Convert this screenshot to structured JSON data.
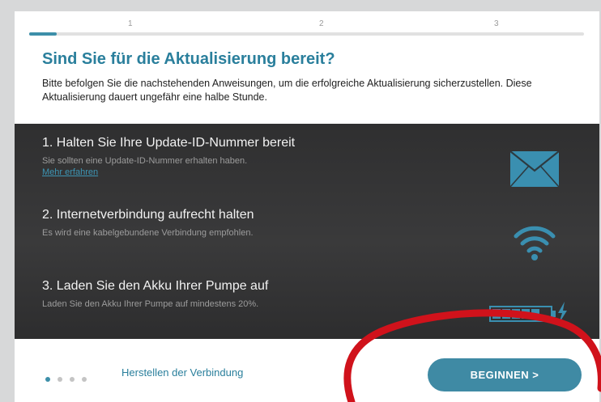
{
  "steps": {
    "labels": [
      "1",
      "2",
      "3"
    ],
    "progress_fraction": 0.05
  },
  "header": {
    "title": "Sind Sie für die Aktualisierung bereit?",
    "intro": "Bitte befolgen Sie die nachstehenden Anweisungen, um die erfolgreiche Aktualisierung sicherzustellen. Diese Aktualisierung dauert ungefähr eine halbe Stunde."
  },
  "instructions": [
    {
      "title": "1. Halten Sie Ihre Update-ID-Nummer bereit",
      "description": "Sie sollten eine Update-ID-Nummer erhalten haben.",
      "link": "Mehr erfahren",
      "icon": "envelope-icon"
    },
    {
      "title": "2. Internetverbindung aufrecht halten",
      "description": "Es wird eine kabelgebundene Verbindung empfohlen.",
      "icon": "wifi-icon"
    },
    {
      "title": "3. Laden Sie den Akku Ihrer Pumpe auf",
      "description": "Laden Sie den Akku Ihrer Pumpe auf mindestens 20%.",
      "icon": "battery-charging-icon"
    }
  ],
  "footer": {
    "dots_total": 4,
    "dot_active_index": 0,
    "step_label": "Herstellen der Verbindung",
    "begin_button": "BEGINNEN >"
  },
  "colors": {
    "accent": "#3d8fa9",
    "title": "#2a7f9c",
    "panel": "#333334",
    "icon": "#3a8fb0",
    "annotation": "#d0121b"
  }
}
